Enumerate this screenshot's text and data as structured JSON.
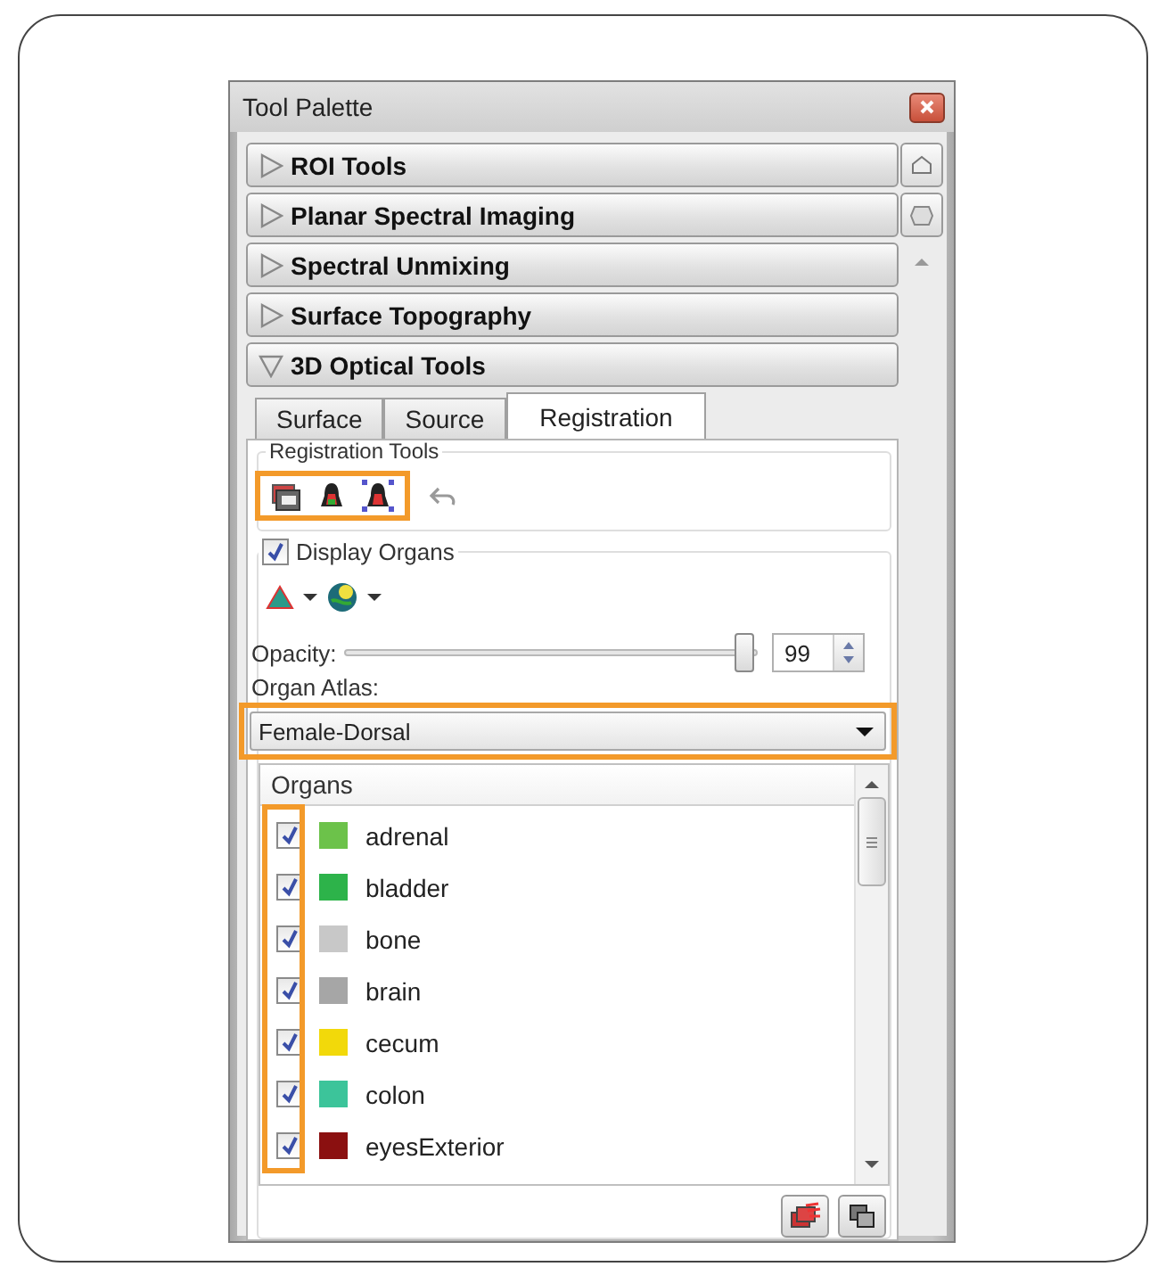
{
  "window": {
    "title": "Tool Palette"
  },
  "sections": [
    {
      "label": "ROI Tools",
      "expanded": false
    },
    {
      "label": "Planar Spectral Imaging",
      "expanded": false
    },
    {
      "label": "Spectral Unmixing",
      "expanded": false
    },
    {
      "label": "Surface Topography",
      "expanded": false
    },
    {
      "label": "3D Optical Tools",
      "expanded": true
    }
  ],
  "tabs": [
    {
      "label": "Surface",
      "selected": false
    },
    {
      "label": "Source",
      "selected": false
    },
    {
      "label": "Registration",
      "selected": true
    }
  ],
  "registration_tools": {
    "label": "Registration Tools"
  },
  "display_organs": {
    "label": "Display Organs",
    "checked": true
  },
  "opacity": {
    "label": "Opacity:",
    "level": 0.99,
    "value": "99"
  },
  "organ_atlas": {
    "label": "Organ Atlas:",
    "value": "Female-Dorsal"
  },
  "organs": {
    "header": "Organs",
    "items": [
      {
        "name": "adrenal",
        "checked": true,
        "color": "#6cc24a"
      },
      {
        "name": "bladder",
        "checked": true,
        "color": "#2db34a"
      },
      {
        "name": "bone",
        "checked": true,
        "color": "#c8c8c8"
      },
      {
        "name": "brain",
        "checked": true,
        "color": "#a6a6a6"
      },
      {
        "name": "cecum",
        "checked": true,
        "color": "#f2d90a"
      },
      {
        "name": "colon",
        "checked": true,
        "color": "#3cc49a"
      },
      {
        "name": "eyesExterior",
        "checked": true,
        "color": "#8b1010"
      }
    ]
  }
}
